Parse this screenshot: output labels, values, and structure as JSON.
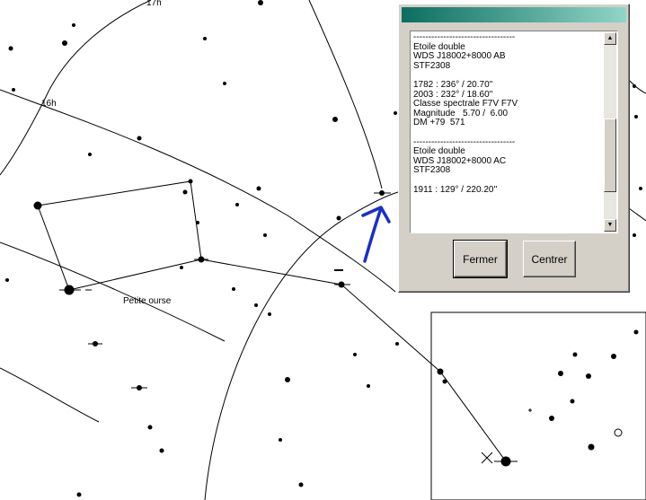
{
  "chart": {
    "ra_labels": [
      "17h",
      "16h"
    ],
    "constellation_name": "Petite ourse"
  },
  "info_window": {
    "title": "",
    "lines": [
      "----------------------------------",
      "Etoile double",
      "WDS J18002+8000 AB",
      "STF2308",
      "",
      "1782 : 236° / 20.70''",
      "2003 : 232° / 18.60''",
      "Classe spectrale F7V F7V",
      "Magnitude   5.70 /  6.00",
      "DM +79  571",
      "",
      "----------------------------------",
      "Etoile double",
      "WDS J18002+8000 AC",
      "STF2308",
      "",
      "1911 : 129° / 220.20''"
    ],
    "scroll_up_icon": "arrow-up-icon",
    "scroll_down_icon": "arrow-down-icon"
  },
  "buttons": {
    "close_label": "Fermer",
    "center_label": "Centrer"
  },
  "colors": {
    "pointer_arrow": "#1a2fc8",
    "titlebar_start": "#0b6e60",
    "titlebar_end": "#8fd6c7",
    "dialog_face": "#d4d0c8"
  }
}
